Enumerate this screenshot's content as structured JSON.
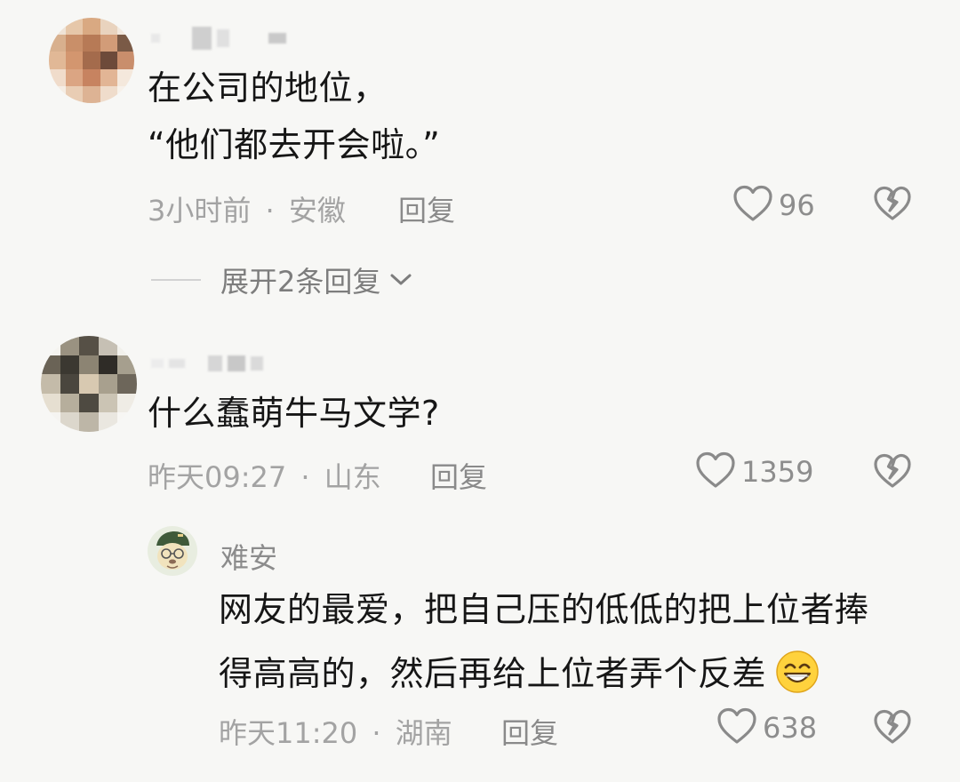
{
  "comments": [
    {
      "lines": [
        "在公司的地位，",
        "“他们都去开会啦。”"
      ],
      "time": "3小时前",
      "sep": "·",
      "location": "安徽",
      "reply_label": "回复",
      "likes": "96",
      "expand_label": "展开2条回复"
    },
    {
      "lines": [
        "什么蠢萌牛马文学?"
      ],
      "time": "昨天09:27",
      "sep": "·",
      "location": "山东",
      "reply_label": "回复",
      "likes": "1359",
      "reply": {
        "username": "难安",
        "lines": [
          "网友的最爱，把自己压的低低的把上位者捧",
          "得高高的，然后再给上位者弄个反差"
        ],
        "time": "昨天11:20",
        "sep": "·",
        "location": "湖南",
        "reply_label": "回复",
        "likes": "638"
      }
    }
  ],
  "icons": {
    "like": "heart-outline-icon",
    "dislike": "broken-heart-icon",
    "expand": "chevron-down-icon",
    "emoji": "grin-emoji-icon"
  },
  "colors": {
    "background": "#f7f7f5",
    "text": "#161616",
    "meta": "#a3a3a3"
  }
}
